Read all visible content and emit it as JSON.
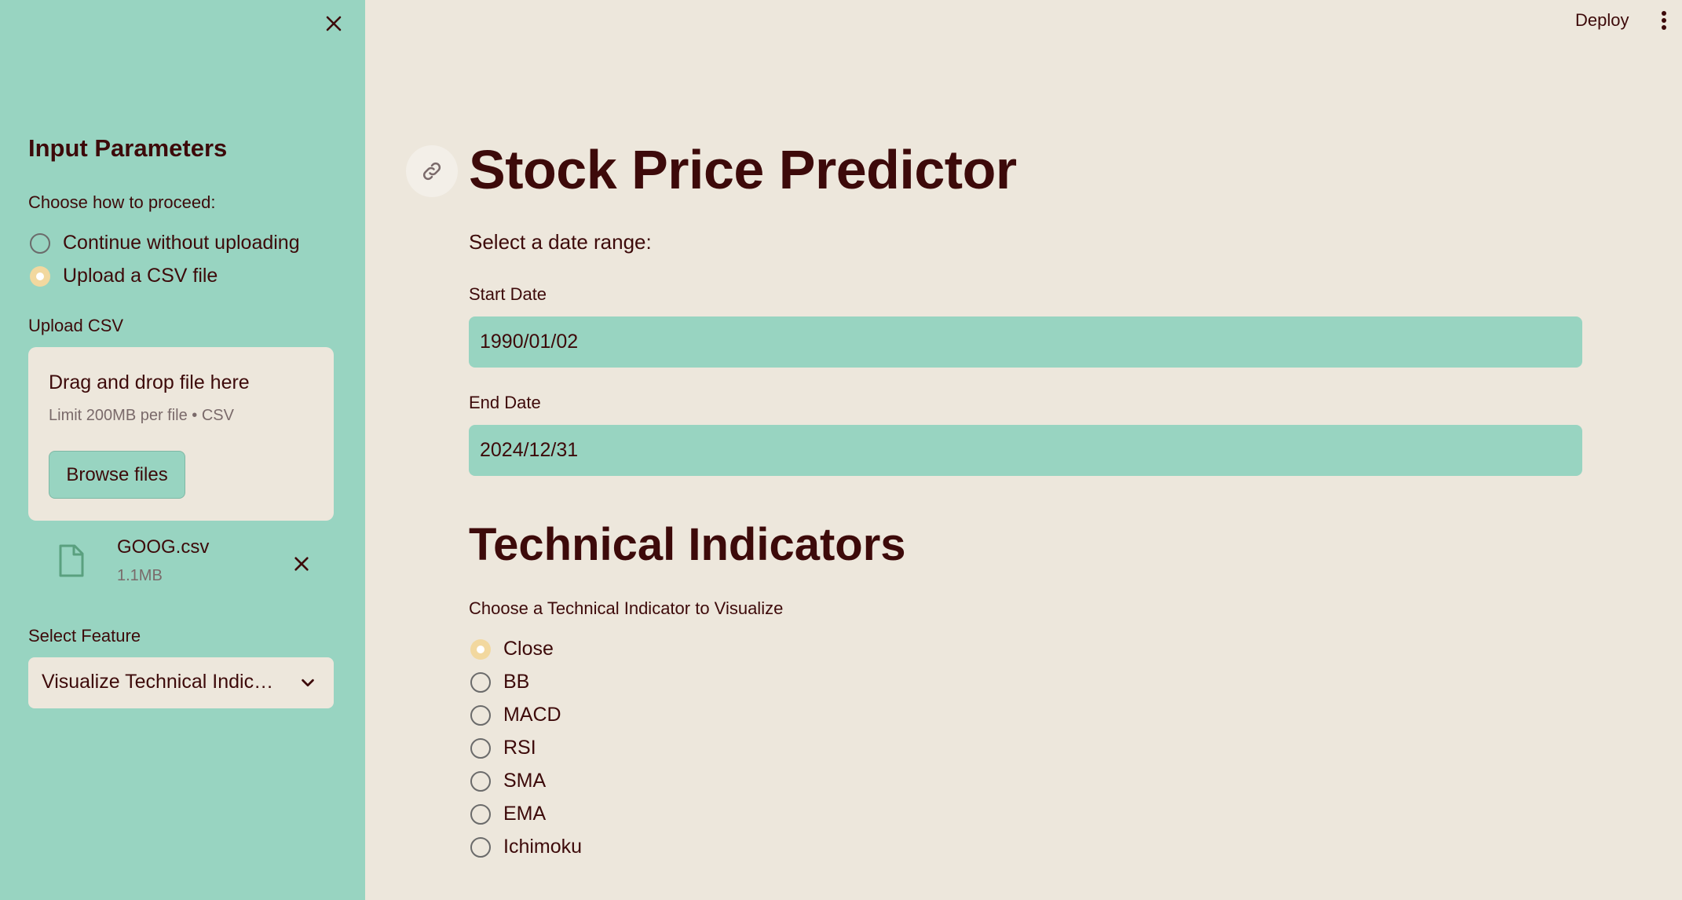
{
  "sidebar": {
    "header": "Input Parameters",
    "proceed_label": "Choose how to proceed:",
    "proceed_options": [
      {
        "label": "Continue without uploading",
        "selected": false
      },
      {
        "label": "Upload a CSV file",
        "selected": true
      }
    ],
    "upload_label": "Upload CSV",
    "dropzone": {
      "title": "Drag and drop file here",
      "subtitle": "Limit 200MB per file • CSV",
      "browse_label": "Browse files"
    },
    "uploaded_file": {
      "name": "GOOG.csv",
      "size": "1.1MB"
    },
    "feature_label": "Select Feature",
    "feature_value": "Visualize Technical Indic…"
  },
  "header": {
    "deploy_label": "Deploy"
  },
  "main": {
    "title": "Stock Price Predictor",
    "date_range_label": "Select a date range:",
    "start_date": {
      "label": "Start Date",
      "value": "1990/01/02"
    },
    "end_date": {
      "label": "End Date",
      "value": "2024/12/31"
    },
    "section_title": "Technical Indicators",
    "indicator_label": "Choose a Technical Indicator to Visualize",
    "indicators": [
      {
        "label": "Close",
        "selected": true
      },
      {
        "label": "BB",
        "selected": false
      },
      {
        "label": "MACD",
        "selected": false
      },
      {
        "label": "RSI",
        "selected": false
      },
      {
        "label": "SMA",
        "selected": false
      },
      {
        "label": "EMA",
        "selected": false
      },
      {
        "label": "Ichimoku",
        "selected": false
      }
    ]
  },
  "colors": {
    "sidebar_bg": "#98d4c1",
    "main_bg": "#ede7dc",
    "text": "#3d0a0a",
    "radio_selected": "#f2d89f",
    "file_icon": "#5aa07f"
  }
}
